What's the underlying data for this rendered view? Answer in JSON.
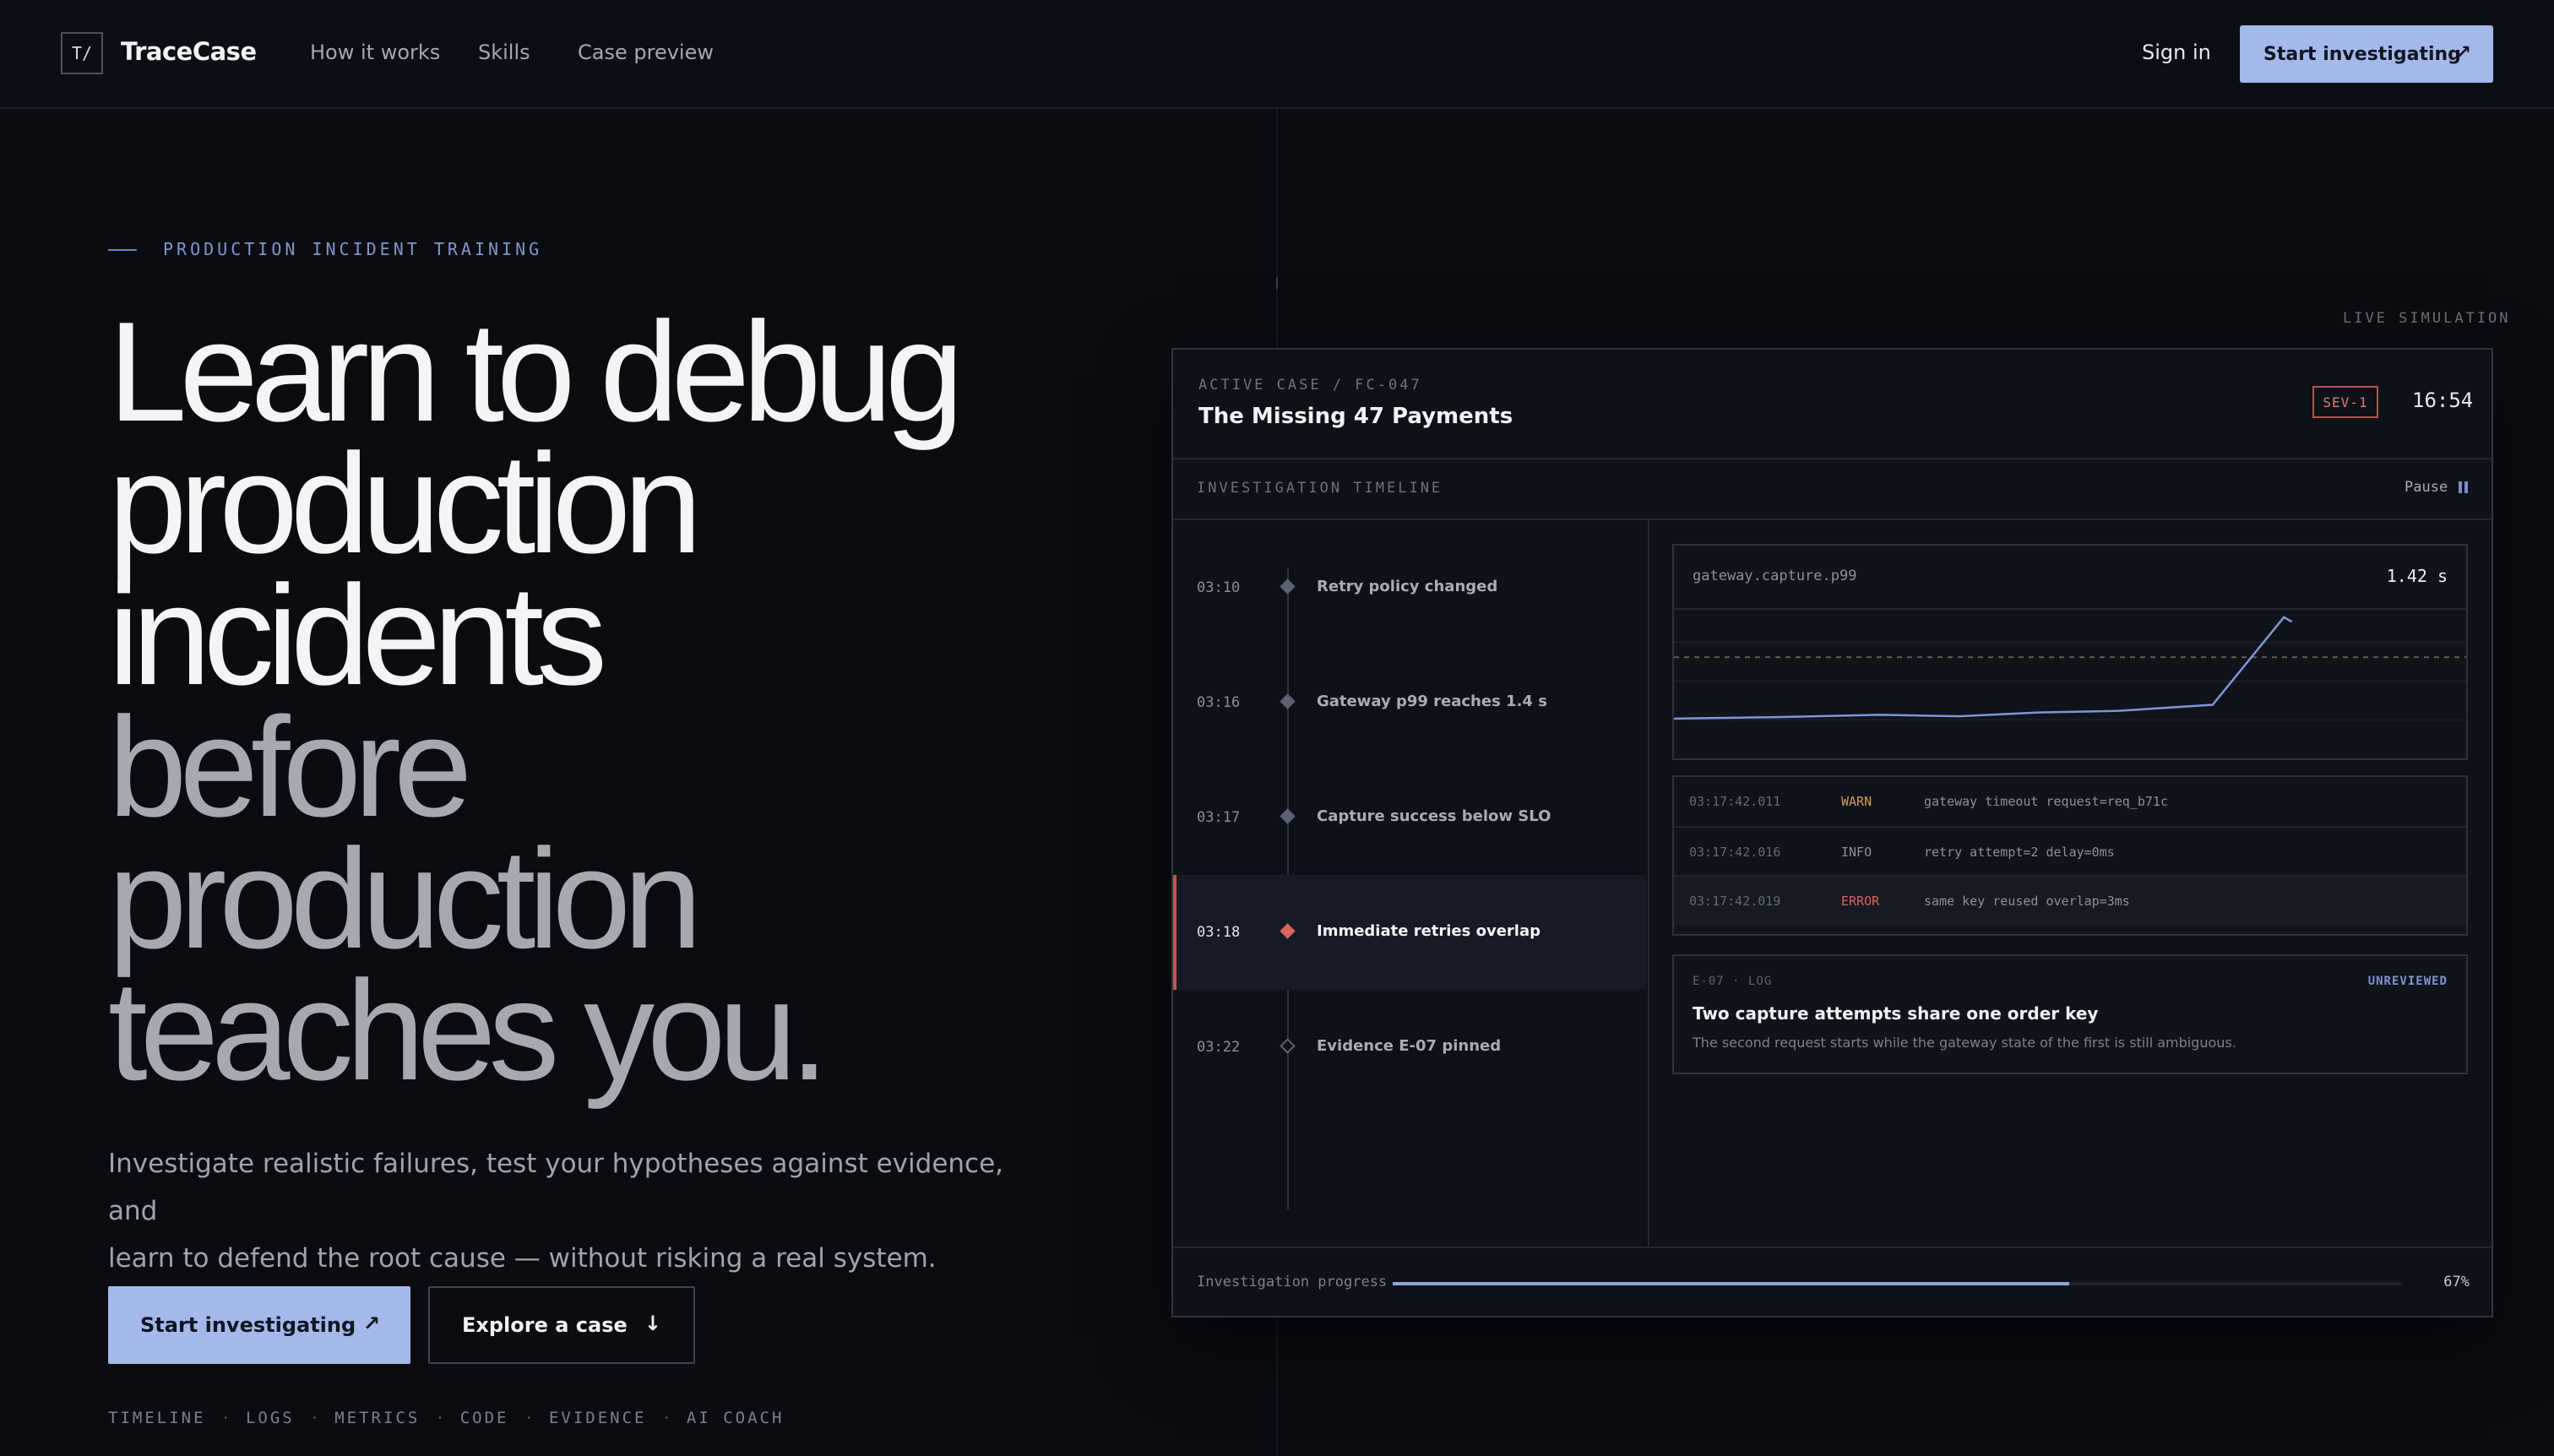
{
  "nav": {
    "logo_mark": "T/",
    "brand": "TraceCase",
    "links": [
      "How it works",
      "Skills",
      "Case preview"
    ],
    "sign_in": "Sign in",
    "cta": "Start investigating",
    "cta_icon": "arrow-up-right-icon"
  },
  "hero": {
    "eyebrow": "PRODUCTION INCIDENT TRAINING",
    "headline_lines": [
      "Learn to debug",
      "production",
      "incidents",
      "before",
      "production",
      "teaches you."
    ],
    "lead_line1": "Investigate realistic failures, test your hypotheses against evidence, and",
    "lead_line2": "learn to defend the root cause — without risking a real system.",
    "primary_button": "Start investigating",
    "secondary_button": "Explore a case",
    "skills": [
      "TIMELINE",
      "LOGS",
      "METRICS",
      "CODE",
      "EVIDENCE",
      "AI COACH"
    ]
  },
  "console": {
    "live_label": "LIVE SIMULATION",
    "case_id": "ACTIVE CASE / FC-047",
    "case_title": "The Missing 47 Payments",
    "severity": "SEV-1",
    "clock": "16:54",
    "timeline_label": "INVESTIGATION TIMELINE",
    "pause_label": "Pause",
    "timeline": [
      {
        "time": "03:10",
        "text": "Retry policy changed",
        "state": "normal"
      },
      {
        "time": "03:16",
        "text": "Gateway p99 reaches 1.4 s",
        "state": "normal"
      },
      {
        "time": "03:17",
        "text": "Capture success below SLO",
        "state": "normal"
      },
      {
        "time": "03:18",
        "text": "Immediate retries overlap",
        "state": "active"
      },
      {
        "time": "03:22",
        "text": "Evidence E-07 pinned",
        "state": "pending"
      }
    ],
    "metric": {
      "name": "gateway.capture.p99",
      "value": "1.42 s",
      "series": [
        0.1,
        0.12,
        0.15,
        0.13,
        0.18,
        0.2,
        0.28,
        1.42,
        1.36
      ],
      "threshold": 0.9,
      "line_color": "#7f95d6"
    },
    "logs": [
      {
        "ts": "03:17:42.011",
        "level": "WARN",
        "msg": "gateway timeout request=req_b71c",
        "color": "#d59b57"
      },
      {
        "ts": "03:17:42.016",
        "level": "INFO",
        "msg": "retry attempt=2 delay=0ms",
        "color": "#8b909a"
      },
      {
        "ts": "03:17:42.019",
        "level": "ERROR",
        "msg": "same key reused overlap=3ms",
        "color": "#d8665e"
      }
    ],
    "evidence": {
      "id": "E-07 · LOG",
      "flag": "UNREVIEWED",
      "title": "Two capture attempts share one order key",
      "desc": "The second request starts while the gateway state of the first is still ambiguous."
    },
    "progress": {
      "label": "Investigation progress",
      "value": 0.67,
      "text": "67%"
    }
  }
}
